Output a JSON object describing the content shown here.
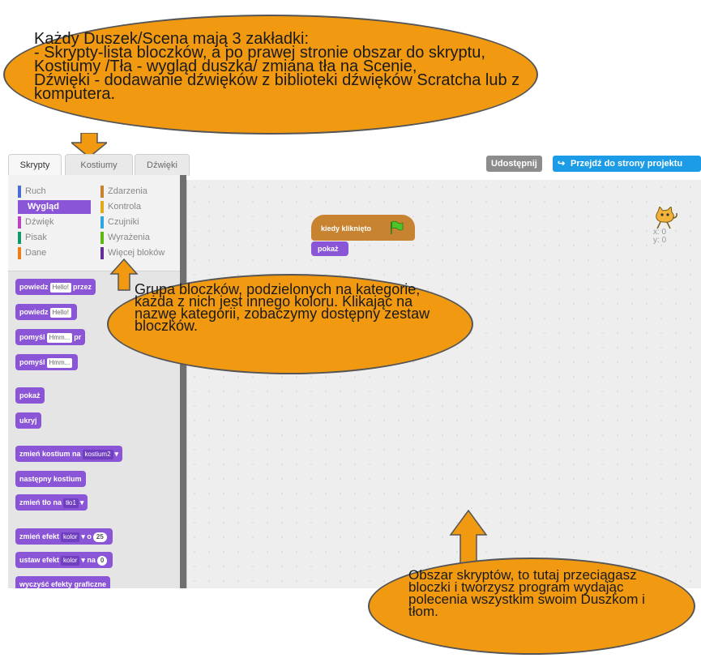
{
  "tabs": [
    {
      "label": "Skrypty"
    },
    {
      "label": "Kostiumy"
    },
    {
      "label": "Dźwięki"
    }
  ],
  "topbar": {
    "share": "Udostępnij",
    "project_page": "Przejdź do strony projektu"
  },
  "categories": [
    {
      "label": "Ruch",
      "color": "#4a6cd4"
    },
    {
      "label": "Zdarzenia",
      "color": "#c88330"
    },
    {
      "label": "Wygląd",
      "color": "#8a55d7"
    },
    {
      "label": "Kontrola",
      "color": "#e1a91a"
    },
    {
      "label": "Dźwięk",
      "color": "#bb42c3"
    },
    {
      "label": "Czujniki",
      "color": "#2ca5e2"
    },
    {
      "label": "Pisak",
      "color": "#0e9a6c"
    },
    {
      "label": "Wyrażenia",
      "color": "#5cb712"
    },
    {
      "label": "Dane",
      "color": "#ee7d16"
    },
    {
      "label": "Więcej bloków",
      "color": "#632d99"
    }
  ],
  "blocks": {
    "say_secs": {
      "label": "powiedz",
      "arg": "Hello!",
      "tail": "przez"
    },
    "say": {
      "label": "powiedz",
      "arg": "Hello!"
    },
    "think_secs": {
      "label": "pomyśl",
      "arg": "Hmm...",
      "tail": "pr"
    },
    "think": {
      "label": "pomyśl",
      "arg": "Hmm..."
    },
    "show": {
      "label": "pokaż"
    },
    "hide": {
      "label": "ukryj"
    },
    "switch_costume": {
      "label": "zmień kostium na",
      "arg": "kostium2"
    },
    "next_costume": {
      "label": "następny kostium"
    },
    "switch_backdrop": {
      "label": "zmień tło na",
      "arg": "tło1"
    },
    "change_effect": {
      "label": "zmień efekt",
      "arg": "kolor",
      "mid": "o",
      "num": "25"
    },
    "set_effect": {
      "label": "ustaw efekt",
      "arg": "kolor",
      "mid": "na",
      "num": "0"
    },
    "clear_effects": {
      "label": "wyczyść efekty graficzne"
    }
  },
  "script": {
    "hat": "kiedy kliknięto",
    "show": "pokaż"
  },
  "sprite": {
    "x": "x: 0",
    "y": "y: 0"
  },
  "callouts": {
    "top": "Każdy Duszek/Scena mają 3 zakładki:\n- Skrypty-lista bloczków, a po prawej stronie obszar do skryptu,\nKostiumy /Tła - wygląd duszka/ zmiana tła na Scenie,\nDźwięki - dodawanie dźwięków z biblioteki  dźwięków Scratcha lub z komputera.",
    "middle": "Grupa bloczków, podzielonych na kategorie, każda z nich jest innego koloru. Klikając na nazwę kategorii, zobaczymy dostępny zestaw bloczków.",
    "bottom": "Obszar skryptów, to tutaj przeciągasz bloczki  i tworzysz program wydając polecenia wszystkim swoim Duszkom i tłom."
  },
  "colors": {
    "callout": "#f19a11",
    "looks": "#8a55d7",
    "events": "#c88330",
    "share": "#8c8c8c",
    "project": "#1c9ce6"
  }
}
